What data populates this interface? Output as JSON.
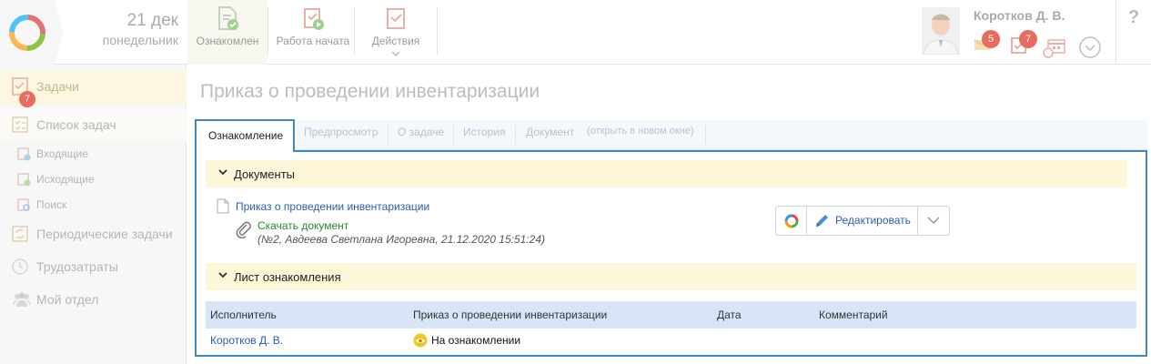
{
  "header": {
    "date_day": "21 дек",
    "date_weekday": "понедельник",
    "toolbar": [
      {
        "label": "Ознакомлен"
      },
      {
        "label": "Работа начата"
      },
      {
        "label": "Действия"
      }
    ],
    "user_name": "Коротков Д. В.",
    "mail_count": "5",
    "task_count": "7",
    "help_label": "?"
  },
  "sidebar": {
    "items": [
      {
        "label": "Задачи",
        "badge": "7"
      },
      {
        "label": "Список задач"
      },
      {
        "label": "Входящие"
      },
      {
        "label": "Исходящие"
      },
      {
        "label": "Поиск"
      },
      {
        "label": "Периодические задачи"
      },
      {
        "label": "Трудозатраты"
      },
      {
        "label": "Мой отдел"
      }
    ]
  },
  "main": {
    "title": "Приказ о проведении инвентаризации",
    "tabs": [
      {
        "label": "Ознакомление"
      },
      {
        "label": "Предпросмотр"
      },
      {
        "label": "О задаче"
      },
      {
        "label": "История"
      },
      {
        "label": "Документ"
      },
      {
        "label": "(открыть в новом окне)"
      }
    ],
    "documents_section": {
      "title": "Документы",
      "doc_name": "Приказ о проведении инвентаризации",
      "download_label": "Скачать документ",
      "doc_meta": "(№2, Авдеева Светлана Игоревна, 21.12.2020 15:51:24)",
      "edit_label": "Редактировать"
    },
    "acquaintance_section": {
      "title": "Лист ознакомления",
      "columns": [
        "Исполнитель",
        "Приказ о проведении инвентаризации",
        "Дата",
        "Комментарий"
      ],
      "rows": [
        {
          "executor": "Коротков Д. В.",
          "status": "На ознакомлении",
          "date": "",
          "comment": ""
        }
      ]
    }
  },
  "colors": {
    "accent_blue": "#3f88c5",
    "link_blue": "#2a5db0",
    "download_green": "#278a2e",
    "section_yellow": "#fef6d8",
    "grid_header_blue": "#d7e5f7",
    "badge_red": "#e86b5d"
  }
}
